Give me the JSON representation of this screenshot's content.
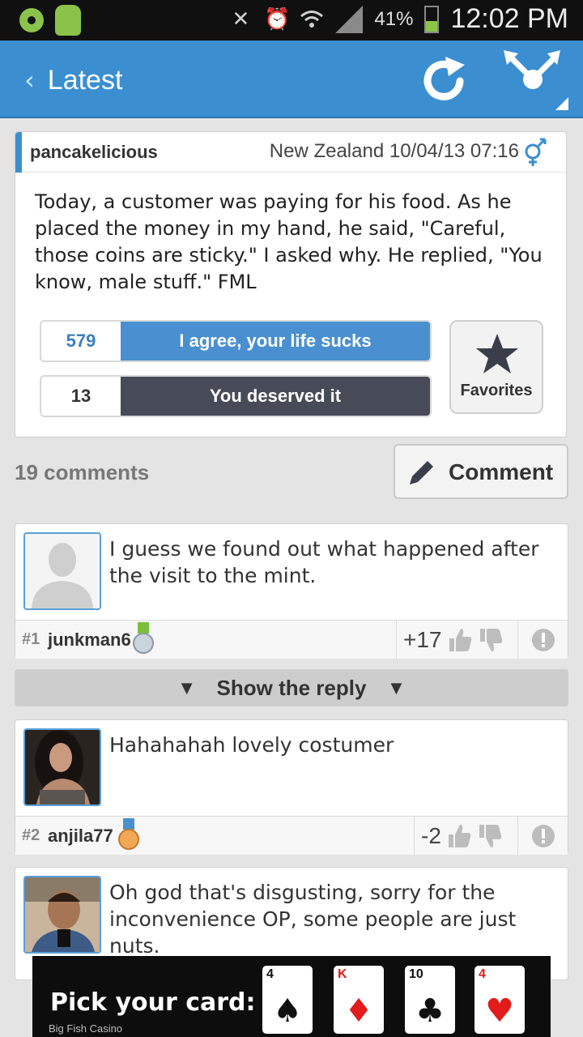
{
  "status_bar": {
    "battery_percent": "41%",
    "battery_level": 0.41,
    "time": "12:02 PM",
    "icons": [
      "wifi-icon",
      "android-icon",
      "mute-icon",
      "alarm-icon",
      "wifi-signal-icon",
      "cell-signal-icon",
      "battery-icon"
    ]
  },
  "action_bar": {
    "title": "Latest",
    "color": "#3b8fd1",
    "refresh_icon": "refresh-icon",
    "gender_icon": "gender-filter-icon"
  },
  "post": {
    "author": "pancakelicious",
    "meta": "New Zealand 10/04/13 07:16",
    "gender_icon": "gender-symbol-icon",
    "body": "Today, a customer was paying for his food. As he placed the money in my hand, he said, \"Careful, those coins are sticky.\" I asked why. He replied, \"You know, male stuff.\" FML",
    "agree_count": "579",
    "agree_label": "I agree, your life sucks",
    "deserve_count": "13",
    "deserve_label": "You deserved it",
    "favorites_label": "Favorites"
  },
  "comments_header": {
    "count": "19 comments",
    "comment_button": "Comment"
  },
  "comments": [
    {
      "num": "#1",
      "user": "junkman6",
      "text": "I guess we found out what happened after the visit to the mint.",
      "score": "+17",
      "medal": "silver"
    },
    {
      "num": "#2",
      "user": "anjila77",
      "text": "Hahahahah lovely costumer",
      "score": "-2",
      "medal": "bronze"
    },
    {
      "text": "Oh god that's disgusting, sorry for the inconvenience OP, some people are just nuts."
    }
  ],
  "reply_bar": {
    "label": "Show the reply"
  },
  "ad": {
    "text": "Pick your card:",
    "brand": "Big Fish Casino",
    "cards": [
      {
        "rank": "4",
        "suit": "♠"
      },
      {
        "rank": "K",
        "suit": "♦"
      },
      {
        "rank": "10",
        "suit": "♣"
      },
      {
        "rank": "4",
        "suit": "♥"
      }
    ]
  }
}
